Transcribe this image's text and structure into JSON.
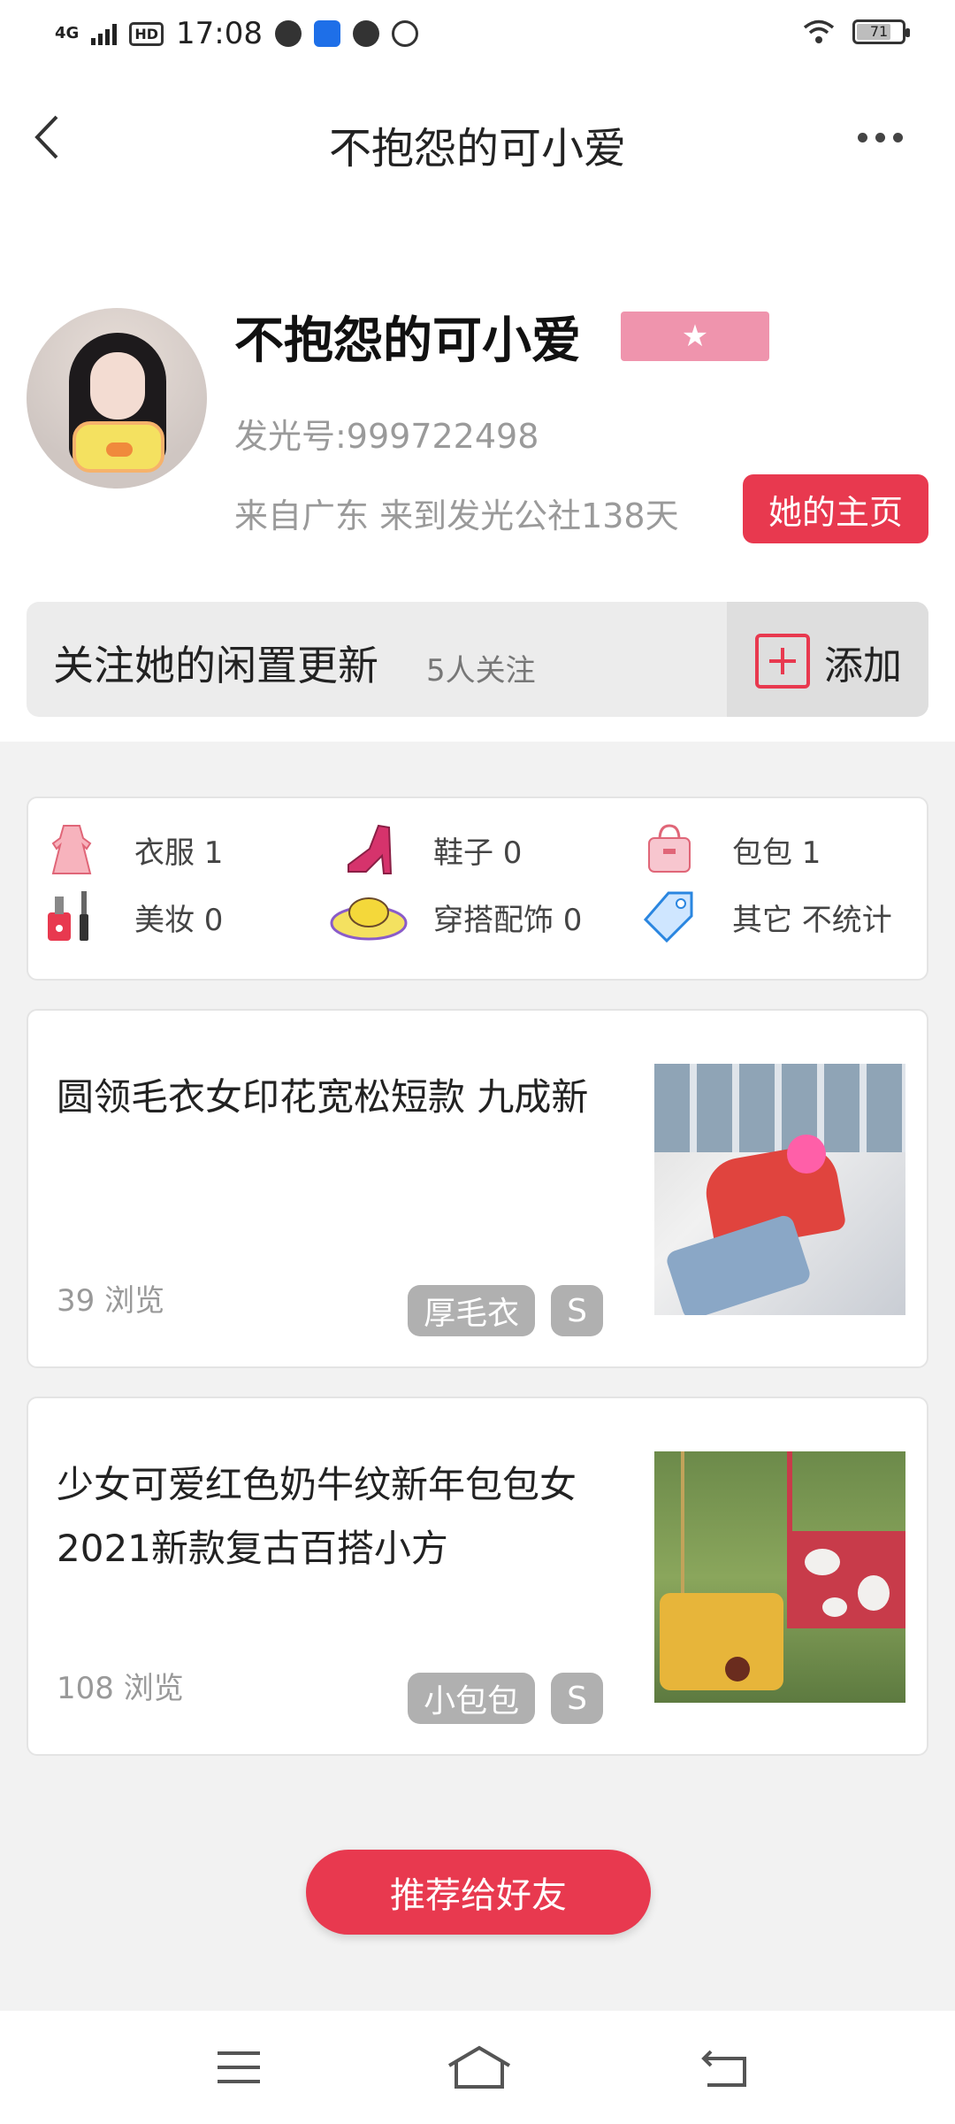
{
  "status_bar": {
    "network": "4G",
    "hd": "HD",
    "time": "17:08",
    "battery": "71"
  },
  "nav": {
    "title": "不抱怨的可小爱"
  },
  "profile": {
    "name": "不抱怨的可小爱",
    "badge_icon": "★",
    "id_text": "发光号:999722498",
    "from_text": "来自广东 来到发光公社138天",
    "home_button": "她的主页"
  },
  "follow": {
    "title": "关注她的闲置更新",
    "count": "5人关注",
    "add_label": "添加"
  },
  "categories": [
    {
      "label": "衣服 1",
      "icon": "dress-icon"
    },
    {
      "label": "鞋子 0",
      "icon": "heel-shoe-icon"
    },
    {
      "label": "包包 1",
      "icon": "handbag-icon"
    },
    {
      "label": "美妆 0",
      "icon": "makeup-icon"
    },
    {
      "label": "穿搭配饰 0",
      "icon": "sun-hat-icon"
    },
    {
      "label": "其它 不统计",
      "icon": "price-tag-icon"
    }
  ],
  "listings": [
    {
      "title": "圆领毛衣女印花宽松短款 九成新",
      "views": "39 浏览",
      "tags": [
        "厚毛衣",
        "S"
      ]
    },
    {
      "title": "少女可爱红色奶牛纹新年包包女2021新款复古百搭小方",
      "views": "108 浏览",
      "tags": [
        "小包包",
        "S"
      ]
    }
  ],
  "recommend_button": "推荐给好友",
  "colors": {
    "accent": "#e8394f",
    "badge": "#ef94ad",
    "tag": "#b0b0b0"
  }
}
